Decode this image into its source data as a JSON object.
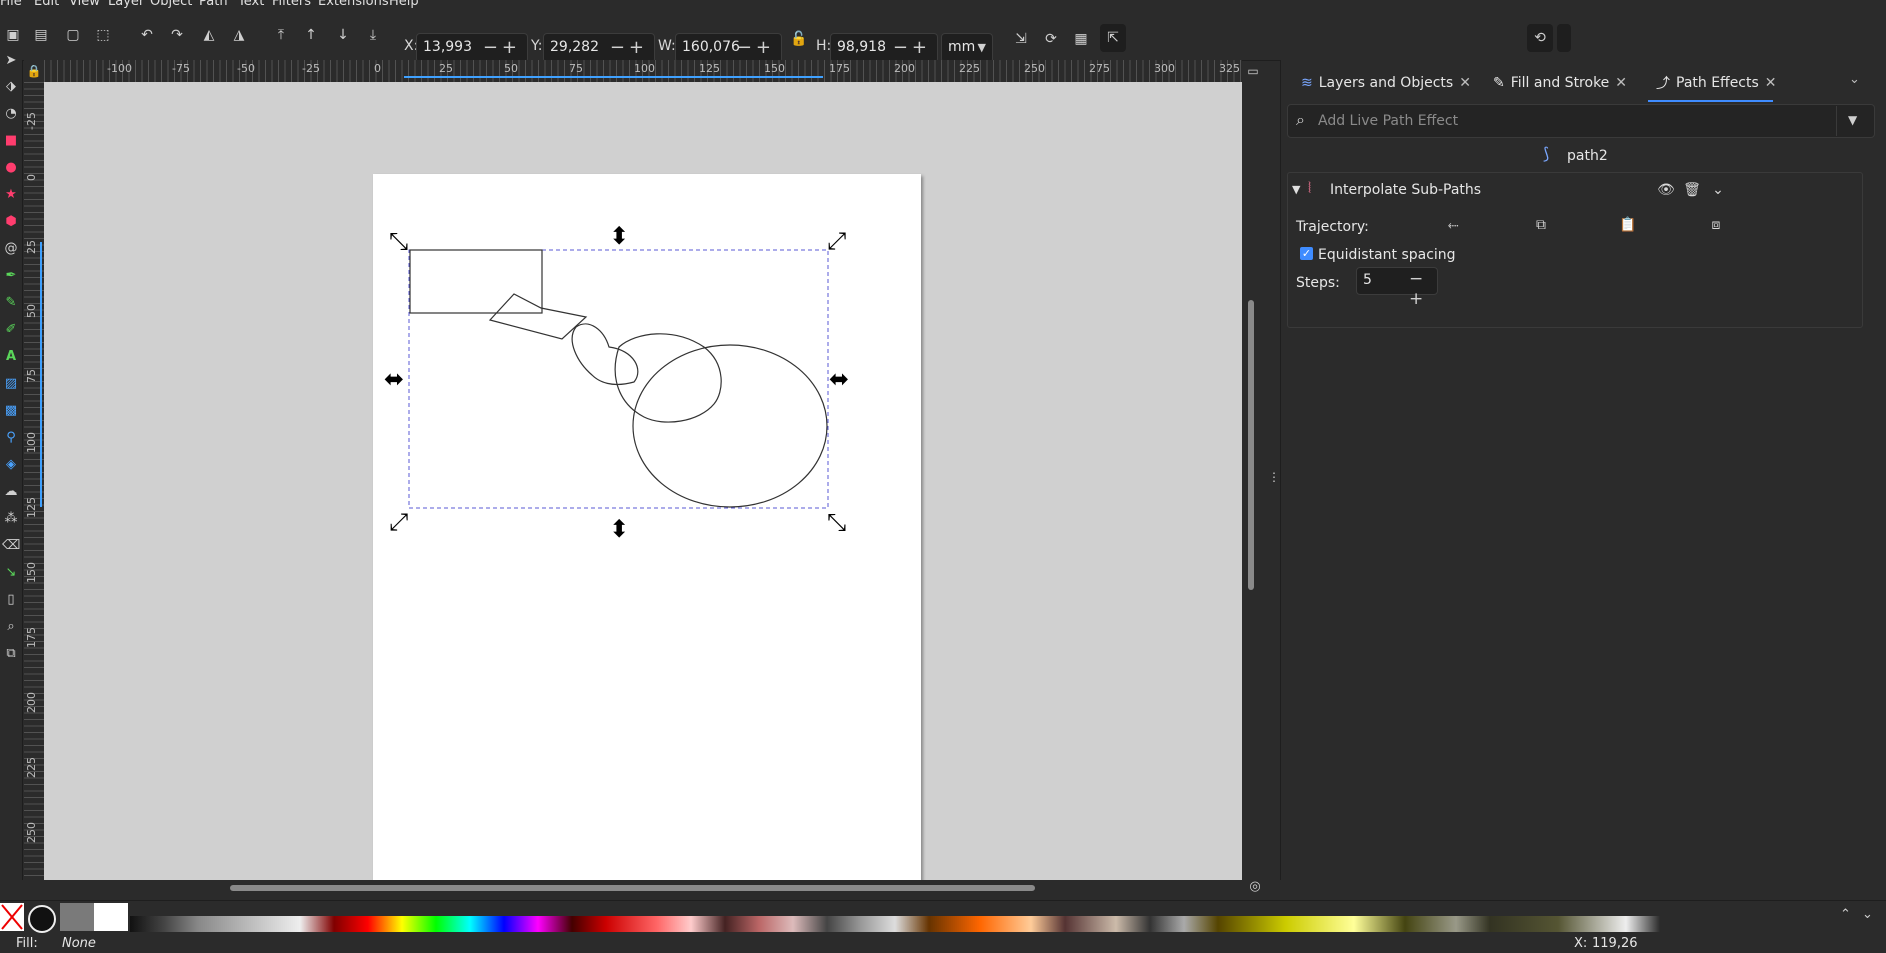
{
  "menu": [
    "File",
    "Edit",
    "View",
    "Layer",
    "Object",
    "Path",
    "Text",
    "Filters",
    "Extensions",
    "Help"
  ],
  "toolbar": {
    "x_label": "X:",
    "x_value": "13,993",
    "y_label": "Y:",
    "y_value": "29,282",
    "w_label": "W:",
    "w_value": "160,076",
    "h_label": "H:",
    "h_value": "98,918",
    "unit": "mm"
  },
  "ruler_top": [
    "-100",
    "-75",
    "-50",
    "-25",
    "0",
    "25",
    "50",
    "75",
    "100",
    "125",
    "150",
    "175",
    "200",
    "225",
    "250",
    "275",
    "300",
    "325"
  ],
  "ruler_left": [
    "-25",
    "0",
    "25",
    "50",
    "75",
    "100",
    "125",
    "150",
    "175",
    "200",
    "225",
    "250"
  ],
  "dock": {
    "tabs": [
      {
        "label": "Layers and Objects",
        "icon": "layers-icon"
      },
      {
        "label": "Fill and Stroke",
        "icon": "fill-stroke-icon"
      },
      {
        "label": "Path Effects",
        "icon": "path-effects-icon"
      }
    ],
    "search_placeholder": "Add Live Path Effect",
    "object_name": "path2",
    "effect": {
      "name": "Interpolate Sub-Paths",
      "trajectory_label": "Trajectory:",
      "equidistant_label": "Equidistant spacing",
      "equidistant_checked": true,
      "steps_label": "Steps:",
      "steps_value": "5"
    }
  },
  "palette": [
    "#ff0000",
    "#800000",
    "#00ff00",
    "#008000",
    "#00ffff",
    "#008080",
    "#0000ff",
    "#000080",
    "#ff00ff",
    "#800080",
    "#ffff00",
    "#808000"
  ],
  "status": {
    "fill_label": "Fill:",
    "fill_value": "None",
    "x_label": "X:",
    "x_value": "119,26"
  }
}
